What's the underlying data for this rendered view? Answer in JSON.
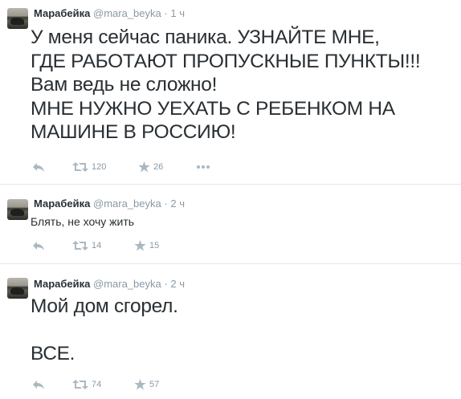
{
  "tweets": [
    {
      "author": "Марабейка",
      "handle": "@mara_beyka",
      "separator": "·",
      "time": "1 ч",
      "lines": [
        "У меня сейчас паника. УЗНАЙТЕ МНЕ,",
        "ГДЕ РАБОТАЮТ ПРОПУСКНЫЕ ПУНКТЫ!!!",
        "Вам ведь не сложно!",
        "МНЕ НУЖНО УЕХАТЬ С РЕБЕНКОМ НА",
        "МАШИНЕ В РОССИЮ!"
      ],
      "retweets": "120",
      "favorites": "26",
      "more_glyph": "•••"
    },
    {
      "author": "Марабейка",
      "handle": "@mara_beyka",
      "separator": "·",
      "time": "2 ч",
      "lines": [
        "Блять, не хочу жить"
      ],
      "retweets": "14",
      "favorites": "15"
    },
    {
      "author": "Марабейка",
      "handle": "@mara_beyka",
      "separator": "·",
      "time": "2 ч",
      "lines": [
        "Мой дом сгорел.",
        "",
        "ВСЕ."
      ],
      "retweets": "74",
      "favorites": "57"
    }
  ],
  "colors": {
    "text": "#292f33",
    "meta": "#8899a6",
    "icon": "#aab8c2",
    "divider": "#e1e8ed"
  },
  "icons": [
    "reply-icon",
    "retweet-icon",
    "favorite-star-icon",
    "more-icon"
  ]
}
